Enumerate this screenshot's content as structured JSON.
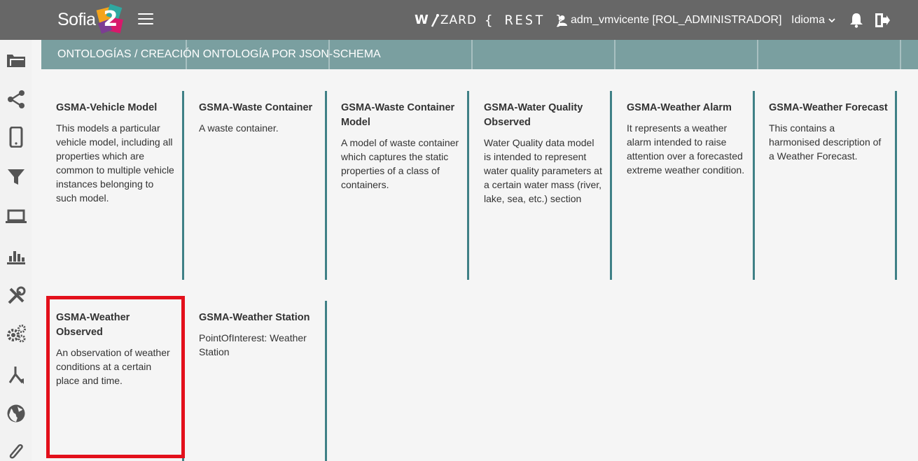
{
  "header": {
    "logo_text": "Sofia",
    "logo_number": "2",
    "wizard_prefix": "W",
    "wizard_suffix": "ZARD",
    "rest_label": "{ REST }",
    "user_label": "adm_vmvicente [ROL_ADMINISTRADOR]",
    "language_label": "Idioma"
  },
  "breadcrumb": {
    "title": "ONTOLOGÍAS / CREACIÓN ONTOLOGÍA POR JSON-SCHEMA"
  },
  "sidebar": {
    "items": [
      {
        "icon": "folder-icon"
      },
      {
        "icon": "share-icon"
      },
      {
        "icon": "mobile-icon"
      },
      {
        "icon": "filter-icon"
      },
      {
        "icon": "laptop-icon"
      },
      {
        "icon": "bar-chart-icon"
      },
      {
        "icon": "tools-icon"
      },
      {
        "icon": "cogs-icon"
      },
      {
        "icon": "branch-icon"
      },
      {
        "icon": "globe-icon"
      },
      {
        "icon": "paperclip-icon"
      }
    ]
  },
  "cards": [
    {
      "title": "GSMA-Vehicle Model",
      "description": "This models a particular vehicle model, including all properties which are common to multiple vehicle instances belonging to such model."
    },
    {
      "title": "GSMA-Waste Container",
      "description": "A waste container."
    },
    {
      "title": "GSMA-Waste Container Model",
      "description": "A model of waste container which captures the static properties of a class of containers."
    },
    {
      "title": "GSMA-Water Quality Observed",
      "description": "Water Quality data model is intended to represent water quality parameters at a certain water mass (river, lake, sea, etc.) section"
    },
    {
      "title": "GSMA-Weather Alarm",
      "description": "It represents a weather alarm intended to raise attention over a forecasted extreme weather condition."
    },
    {
      "title": "GSMA-Weather Forecast",
      "description": "This contains a harmonised description of a Weather Forecast."
    },
    {
      "title": "GSMA-Weather Observed",
      "description": "An observation of weather conditions at a certain place and time."
    },
    {
      "title": "GSMA-Weather Station",
      "description": "PointOfInterest: Weather Station"
    }
  ],
  "colors": {
    "topbar": "#676767",
    "pagebar": "#7a9fa0",
    "card_divider": "#3f8086",
    "highlight": "#e3101b"
  }
}
